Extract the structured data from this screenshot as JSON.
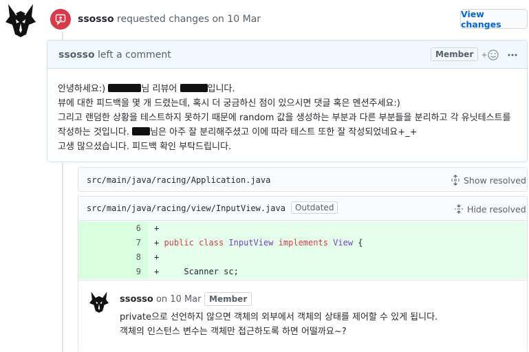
{
  "review": {
    "author": "ssosso",
    "action": "requested changes on 10 Mar",
    "view_changes_label": "View changes",
    "badge_icon": "file-diff-icon",
    "badge_color": "#d73a49"
  },
  "comment": {
    "author": "ssosso",
    "action": "left a comment",
    "role_badge": "Member",
    "line1_a": "안녕하세요:) ",
    "line1_b": "님 리뷰어 ",
    "line1_c": "입니다.",
    "line2": "뷰에 대한 피드백을 몇 개 드렸는데, 혹시 더 궁금하신 점이 있으시면 댓글 혹은 멘션주세요:)",
    "line3": "그리고 랜덤한 상황을 테스트하지 못하기 때문에 random 값을 생성하는 부분과 다른 부분들을 분리하고 각 유닛테스트를",
    "line4_a": "작성하는 것입니다. ",
    "line4_b": "님은 아주 잘 분리해주셨고 이에 따라 테스트 또한 잘 작성되었네요+_+",
    "line5": "고생 많으셨습니다. 피드백 확인 부탁드립니다."
  },
  "files": [
    {
      "path": "src/main/java/racing/Application.java",
      "toggle_label": "Show resolved"
    },
    {
      "path": "src/main/java/racing/view/InputView.java",
      "outdated_label": "Outdated",
      "toggle_label": "Hide resolved"
    }
  ],
  "diff": {
    "line_numbers": [
      "6",
      "7",
      "8",
      "9"
    ],
    "l6": "+",
    "l7_plus": "+ ",
    "l7_kw1": "public",
    "l7_kw2": "class",
    "l7_type1": "InputView",
    "l7_kw3": "implements",
    "l7_type2": "View",
    "l7_brace": "{",
    "l8": "+",
    "l9": "+     Scanner sc;"
  },
  "reply": {
    "author": "ssosso",
    "date": "on 10 Mar",
    "role_badge": "Member",
    "line1": "private으로 선언하지 않으면 객체의 외부에서 객체의 상태를 제어할 수 있게 됩니다.",
    "line2": "객체의 인스턴스 변수는 객체만 접근하도록 하면 어떨까요~?"
  },
  "colors": {
    "addition_bg": "#e6ffed",
    "addition_num_bg": "#cdffd8",
    "link": "#0366d6",
    "comment_border": "#c8e1ff"
  }
}
